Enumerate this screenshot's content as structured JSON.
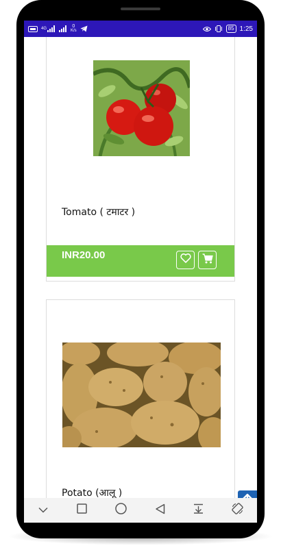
{
  "status_bar": {
    "left_icons": [
      "volte-icon",
      "signal-4g-icon",
      "signal-icon",
      "data-speed-icon",
      "telegram-icon"
    ],
    "data_speed_value": "0",
    "data_speed_unit": "K/s",
    "network_label": "4G",
    "right_icons": [
      "eye-comfort-icon",
      "vibrate-icon",
      "battery-icon"
    ],
    "battery": "85",
    "time": "1:25",
    "bar_color": "#2d17b8"
  },
  "products": [
    {
      "name": "Tomato ( टमाटर )",
      "price": "INR20.00",
      "image": "tomato-image"
    },
    {
      "name": "Potato (आलू )",
      "price": "",
      "image": "potato-image"
    }
  ],
  "colors": {
    "price_bar": "#79c94a",
    "scroll_top_button": "#1e63b3",
    "card_border": "#dcdcdc"
  },
  "nav_bar": {
    "buttons": [
      "chevron-down-icon",
      "recents-square-icon",
      "home-circle-icon",
      "back-triangle-icon",
      "notification-pull-icon",
      "rotate-icon"
    ]
  }
}
